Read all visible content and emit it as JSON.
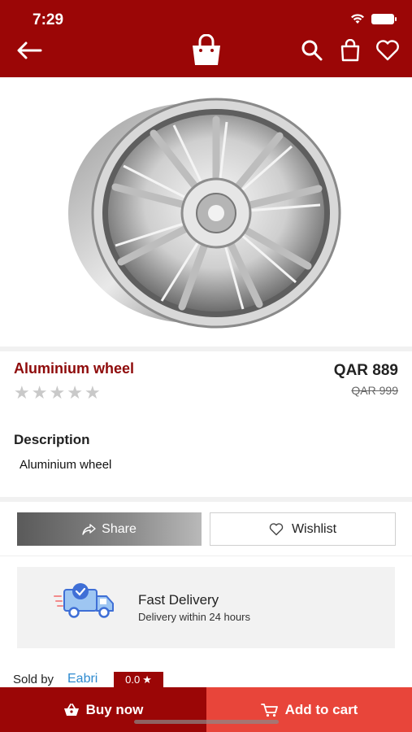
{
  "status_bar": {
    "time": "7:29"
  },
  "product": {
    "title": "Aluminium wheel",
    "price": "QAR 889",
    "old_price": "QAR 999",
    "rating_stars": 0,
    "description_heading": "Description",
    "description": "Aluminium wheel"
  },
  "actions": {
    "share_label": "Share",
    "wishlist_label": "Wishlist"
  },
  "delivery": {
    "title": "Fast Delivery",
    "subtitle": "Delivery within 24 hours"
  },
  "seller": {
    "sold_by_label": "Sold by",
    "name": "Eabri",
    "rating": "0.0"
  },
  "bottom_bar": {
    "buy_now_label": "Buy now",
    "add_to_cart_label": "Add to cart"
  },
  "colors": {
    "brand": "#9b0606",
    "add_to_cart": "#e8453a",
    "seller_link": "#2f8bd0"
  }
}
